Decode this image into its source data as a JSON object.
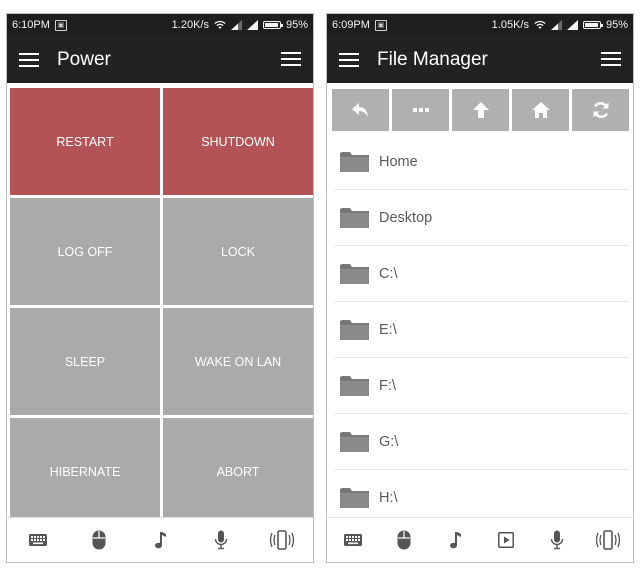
{
  "left": {
    "status": {
      "time": "6:10PM",
      "speed": "1.20K/s",
      "battery": "95%",
      "battery_level": 0.95
    },
    "title": "Power",
    "buttons": [
      {
        "label": "RESTART",
        "color": "#b35355"
      },
      {
        "label": "SHUTDOWN",
        "color": "#b35355"
      },
      {
        "label": "LOG OFF",
        "color": "#aaaaaa"
      },
      {
        "label": "LOCK",
        "color": "#aaaaaa"
      },
      {
        "label": "SLEEP",
        "color": "#aaaaaa"
      },
      {
        "label": "WAKE ON LAN",
        "color": "#aaaaaa"
      },
      {
        "label": "HIBERNATE",
        "color": "#aaaaaa"
      },
      {
        "label": "ABORT",
        "color": "#aaaaaa"
      }
    ],
    "nav": [
      "keyboard-icon",
      "mouse-icon",
      "music-note-icon",
      "microphone-icon",
      "phone-vibrate-icon"
    ]
  },
  "right": {
    "status": {
      "time": "6:09PM",
      "speed": "1.05K/s",
      "battery": "95%",
      "battery_level": 0.95
    },
    "title": "File Manager",
    "toolbar": [
      "back-icon",
      "more-icon",
      "up-arrow-icon",
      "home-icon",
      "refresh-icon"
    ],
    "items": [
      {
        "label": "Home"
      },
      {
        "label": "Desktop"
      },
      {
        "label": "C:\\"
      },
      {
        "label": "E:\\"
      },
      {
        "label": "F:\\"
      },
      {
        "label": "G:\\"
      },
      {
        "label": "H:\\"
      }
    ],
    "nav": [
      "keyboard-icon",
      "mouse-icon",
      "music-note-icon",
      "play-icon",
      "microphone-icon",
      "phone-vibrate-icon"
    ]
  },
  "colors": {
    "appbar": "#222222",
    "statusbar": "#1e1e1e",
    "accent_red": "#b35355",
    "tile_grey": "#aaaaaa",
    "toolbar_grey": "#b0b0b0",
    "icon": "#555555"
  }
}
